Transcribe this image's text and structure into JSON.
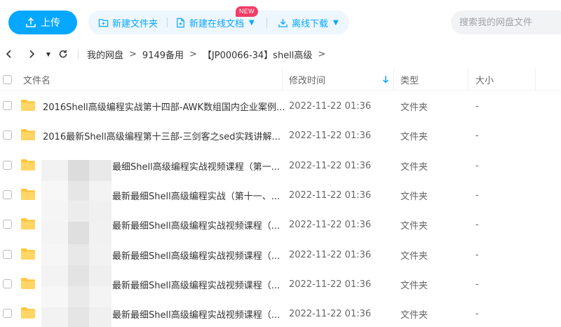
{
  "toolbar": {
    "upload_label": "上传",
    "new_folder_label": "新建文件夹",
    "new_online_doc_label": "新建在线文档",
    "new_badge": "NEW",
    "offline_download_label": "离线下载",
    "search_placeholder": "搜索我的网盘文件",
    "accent_color": "#06a7ff"
  },
  "nav": {
    "back_icon": "chevron-left-icon",
    "forward_icon": "chevron-right-icon",
    "history_icon": "caret-down-icon",
    "refresh_icon": "refresh-icon",
    "breadcrumb": [
      "我的网盘",
      "9149备用",
      "【JP00066-34】shell高级"
    ],
    "separator": ">"
  },
  "table": {
    "columns": {
      "name": "文件名",
      "modified": "修改时间",
      "type": "类型",
      "size": "大小"
    },
    "sorted_by": "修改时间",
    "sort_direction": "desc",
    "rows": [
      {
        "name": "2016Shell高级编程实战第十四部-AWK数组国内企业案例...",
        "modified": "2022-11-22 01:36",
        "type": "文件夹",
        "size": "-"
      },
      {
        "name": "2016最新Shell高级编程第十三部-三剑客之sed实践讲解...",
        "modified": "2022-11-22 01:36",
        "type": "文件夹",
        "size": "-"
      },
      {
        "name": "最细Shell高级编程实战视频课程（第一...",
        "modified": "2022-11-22 01:36",
        "type": "文件夹",
        "size": "-"
      },
      {
        "name": "最新最细Shell高级编程实战（第十一、...",
        "modified": "2022-11-22 01:36",
        "type": "文件夹",
        "size": "-"
      },
      {
        "name": "最新最细Shell高级编程实战视频课程（...",
        "modified": "2022-11-22 01:36",
        "type": "文件夹",
        "size": "-"
      },
      {
        "name": "最新最细Shell高级编程实战视频课程（...",
        "modified": "2022-11-22 01:36",
        "type": "文件夹",
        "size": "-"
      },
      {
        "name": "最新最细Shell高级编程实战视频课程（...",
        "modified": "2022-11-22 01:36",
        "type": "文件夹",
        "size": "-"
      },
      {
        "name": "最新最细Shell高级编程实战视频课程（...",
        "modified": "2022-11-22 01:36",
        "type": "文件夹",
        "size": "-"
      }
    ]
  }
}
